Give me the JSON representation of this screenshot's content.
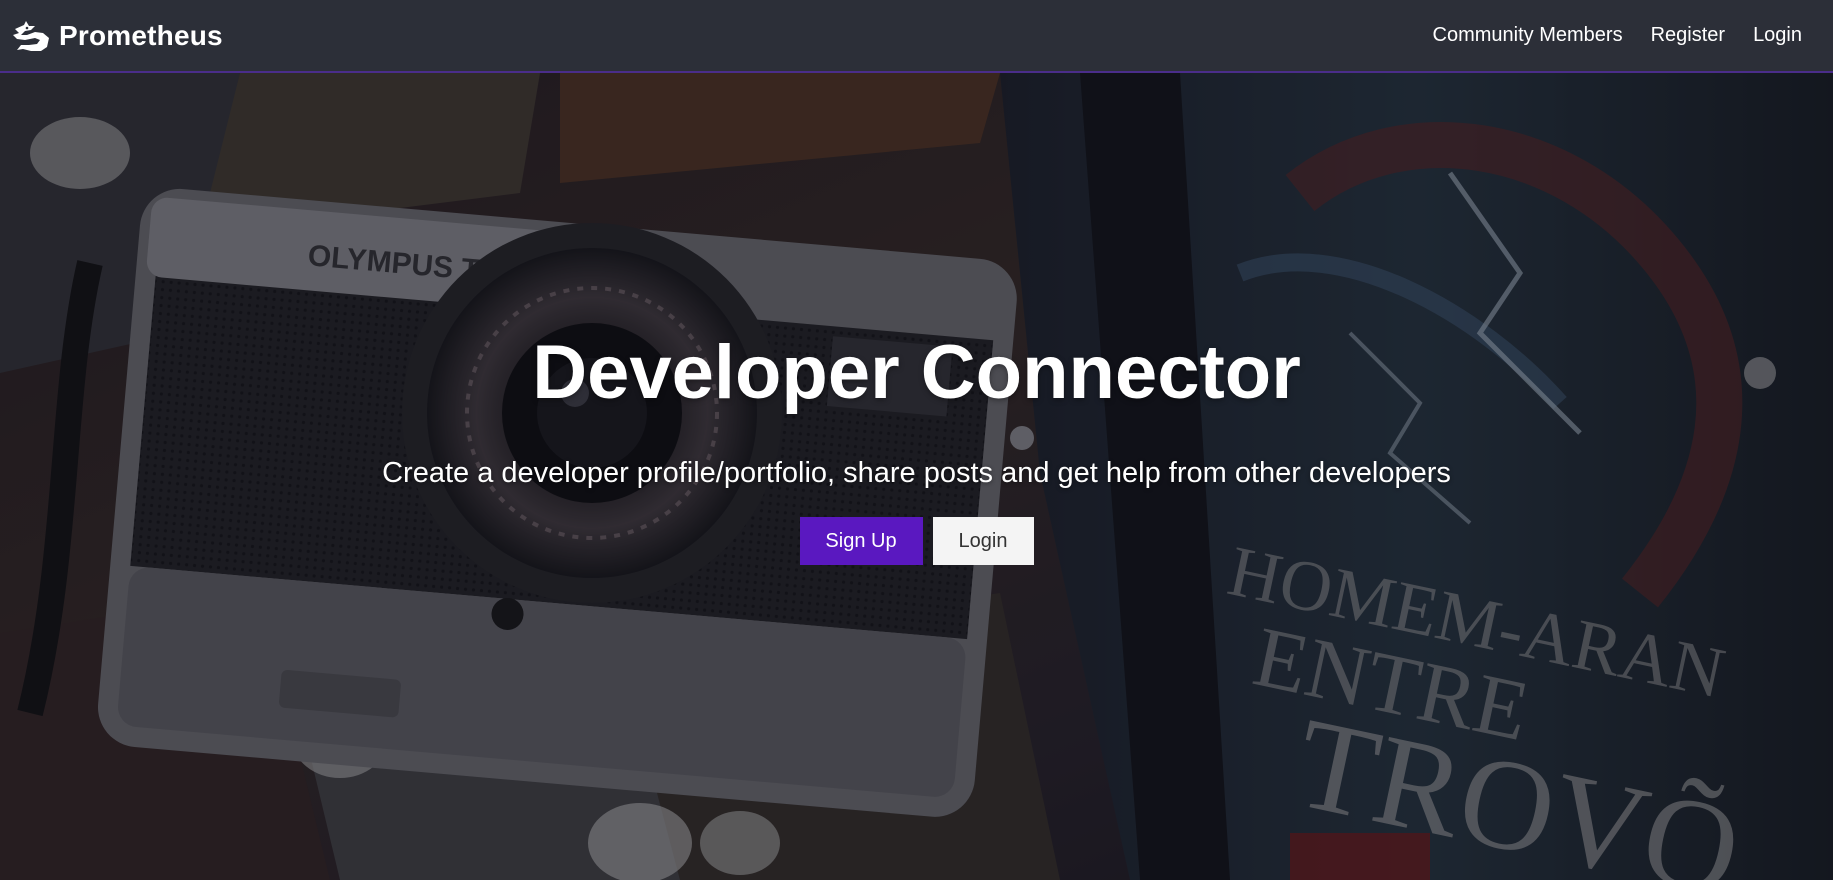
{
  "navbar": {
    "brand_name": "Prometheus",
    "brand_icon": "dragon-logo-icon",
    "links": [
      {
        "label": "Community Members"
      },
      {
        "label": "Register"
      },
      {
        "label": "Login"
      }
    ],
    "accent_color": "#4a2d8a"
  },
  "landing": {
    "title": "Developer Connector",
    "lead": "Create a developer profile/portfolio, share posts and get help from other developers",
    "buttons": {
      "signup_label": "Sign Up",
      "login_label": "Login"
    },
    "primary_color": "#5a18c0",
    "background_image": "camera-on-comic-books-photo"
  }
}
